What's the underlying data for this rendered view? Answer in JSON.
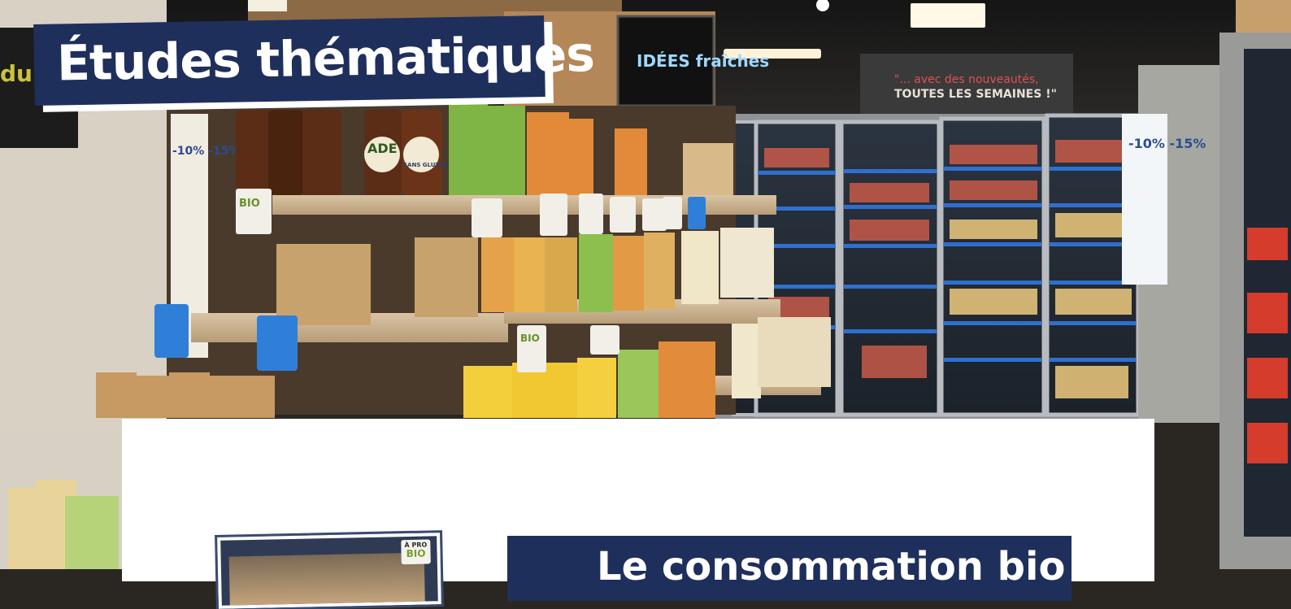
{
  "page": {
    "title": "Études thématiques",
    "store_signs": {
      "ideas_sign": "IDÉES fraîches",
      "weekly_sign_line1": "\"... avec des nouveautés,",
      "weekly_sign_line2": "TOUTES LES SEMAINES !\"",
      "left_edge_sign": "du"
    },
    "shelf_badges": {
      "bio_label": "BIO",
      "gluten_label": "SANS GLUTEN",
      "promo_label": "-10% -15%",
      "ade_label": "ADE"
    },
    "card": {
      "thumbnail_badge_top": "À PRO",
      "thumbnail_badge_bottom": "BIO",
      "article_title_partial": "Le consommation bio"
    }
  },
  "colors": {
    "navy": "#1f2f5c",
    "white": "#ffffff"
  }
}
